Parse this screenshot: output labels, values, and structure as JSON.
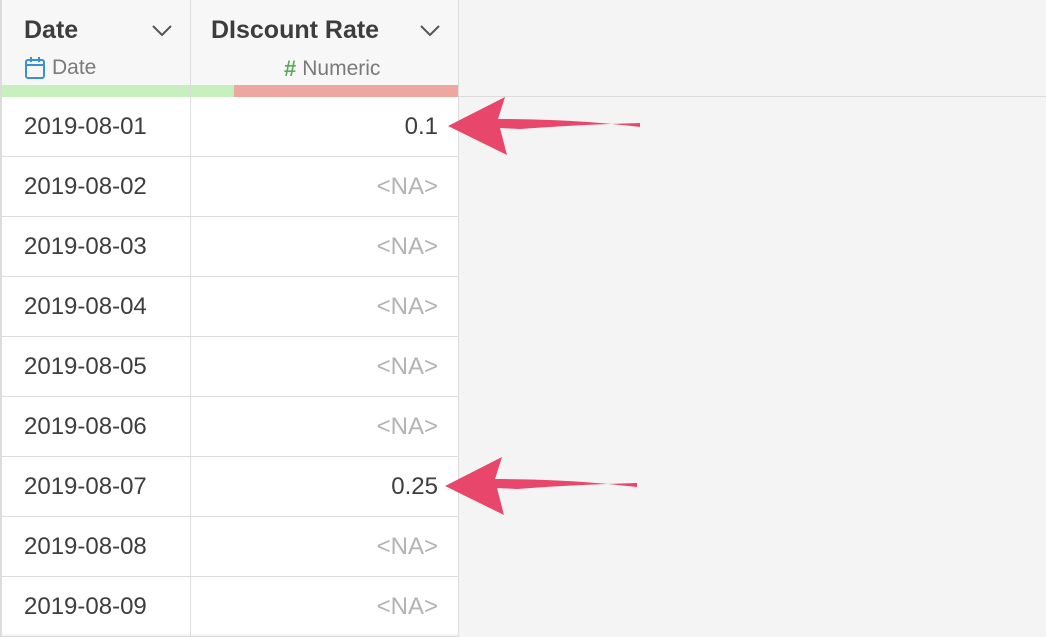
{
  "columns": [
    {
      "title": "Date",
      "type_label": "Date",
      "type_icon": "calendar-icon",
      "quality": {
        "valid_fraction": 1.0
      }
    },
    {
      "title": "DIscount Rate",
      "type_label": "Numeric",
      "type_icon": "hash-icon",
      "quality": {
        "valid_fraction": 0.16
      }
    }
  ],
  "rows": [
    {
      "date": "2019-08-01",
      "discount": "0.1",
      "missing": false
    },
    {
      "date": "2019-08-02",
      "discount": "<NA>",
      "missing": true
    },
    {
      "date": "2019-08-03",
      "discount": "<NA>",
      "missing": true
    },
    {
      "date": "2019-08-04",
      "discount": "<NA>",
      "missing": true
    },
    {
      "date": "2019-08-05",
      "discount": "<NA>",
      "missing": true
    },
    {
      "date": "2019-08-06",
      "discount": "<NA>",
      "missing": true
    },
    {
      "date": "2019-08-07",
      "discount": "0.25",
      "missing": false
    },
    {
      "date": "2019-08-08",
      "discount": "<NA>",
      "missing": true
    },
    {
      "date": "2019-08-09",
      "discount": "<NA>",
      "missing": true
    }
  ],
  "annotations": {
    "arrow_color": "#e8466b",
    "arrow_targets": [
      "row-1-value",
      "row-7-value"
    ]
  },
  "colors": {
    "quality_valid": "#c7f0bf",
    "quality_missing": "#eea7a0",
    "date_icon": "#3b8fd6",
    "numeric_icon": "#5cab5c"
  }
}
